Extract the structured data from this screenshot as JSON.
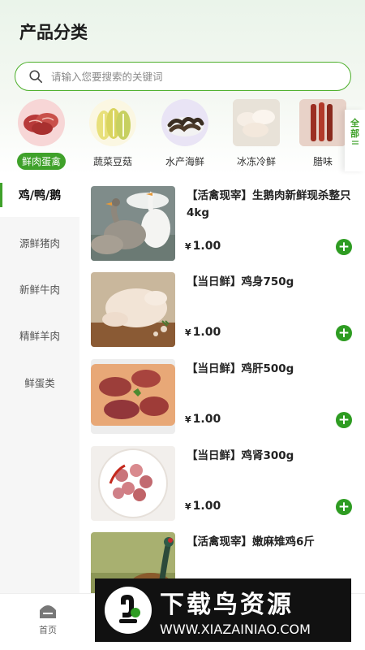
{
  "header": {
    "title": "产品分类"
  },
  "search": {
    "placeholder": "请输入您要搜索的关键词"
  },
  "categories": [
    {
      "label": "鲜肉蛋禽",
      "active": true
    },
    {
      "label": "蔬菜豆菇",
      "active": false
    },
    {
      "label": "水产海鲜",
      "active": false
    },
    {
      "label": "冰冻冷鲜",
      "active": false
    },
    {
      "label": "腊味",
      "active": false
    }
  ],
  "all_button": {
    "label_line1": "全",
    "label_line2": "部"
  },
  "sidebar": {
    "items": [
      {
        "label": "鸡/鸭/鹅",
        "active": true
      },
      {
        "label": "源鲜猪肉",
        "active": false
      },
      {
        "label": "新鲜牛肉",
        "active": false
      },
      {
        "label": "精鲜羊肉",
        "active": false
      },
      {
        "label": "鲜蛋类",
        "active": false
      }
    ]
  },
  "currency": "¥",
  "products": [
    {
      "title": "【活禽现宰】生鹅肉新鲜现杀整只4kg",
      "price": "1.00"
    },
    {
      "title": "【当日鲜】鸡身750g",
      "price": "1.00"
    },
    {
      "title": "【当日鲜】鸡肝500g",
      "price": "1.00"
    },
    {
      "title": "【当日鲜】鸡肾300g",
      "price": "1.00"
    },
    {
      "title": "【活禽现宰】嫩麻雉鸡6斤",
      "price": ""
    }
  ],
  "tabbar": {
    "home_label": "首页"
  },
  "watermark": {
    "title": "下载鸟资源",
    "url": "WWW.XIAZAINIAO.COM"
  },
  "colors": {
    "accent": "#3fa12a",
    "add_button": "#2e9c22",
    "search_border": "#4caf2a"
  }
}
